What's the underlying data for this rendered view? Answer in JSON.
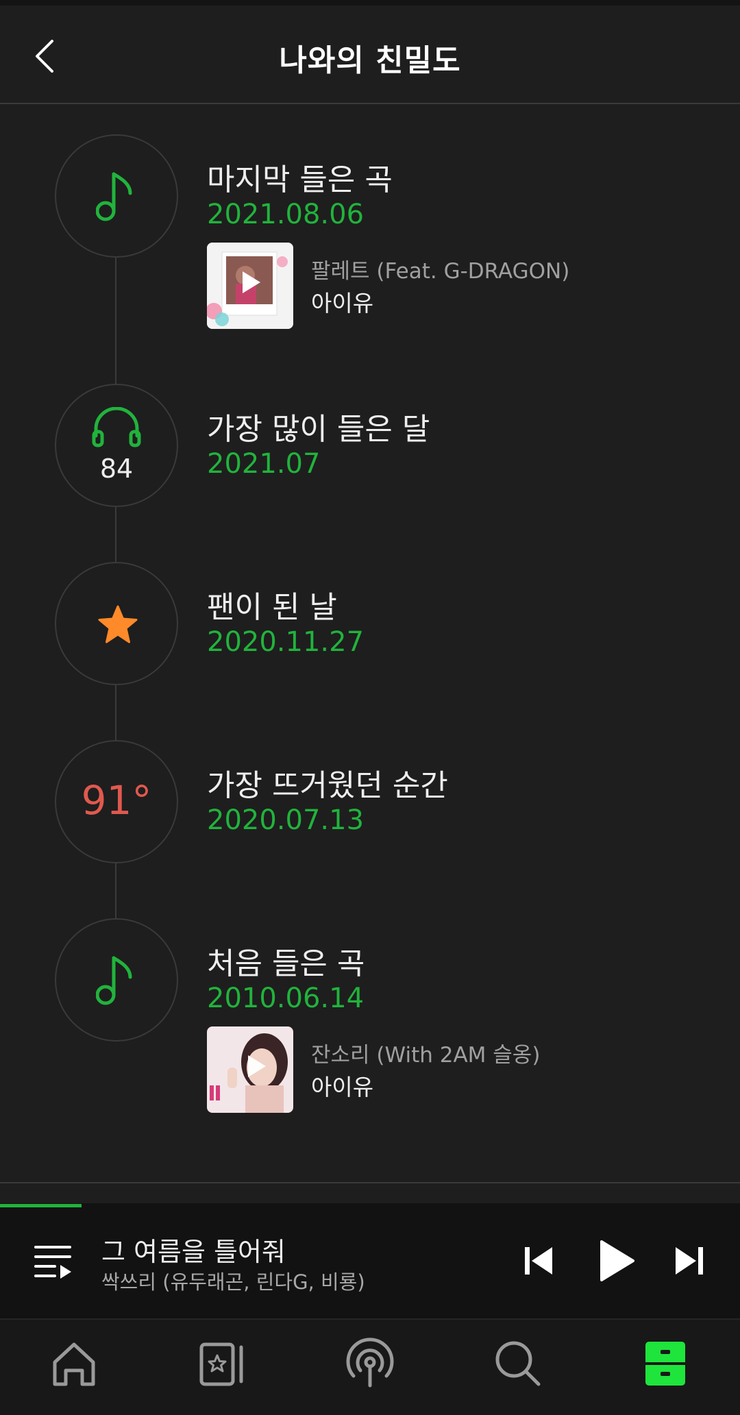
{
  "header": {
    "title": "나와의 친밀도"
  },
  "timeline": [
    {
      "icon": "music-note-icon",
      "title": "마지막 들은 곡",
      "date": "2021.08.06",
      "song": {
        "title": "팔레트 (Feat. G-DRAGON)",
        "artist": "아이유"
      }
    },
    {
      "icon": "headphones-icon",
      "count": "84",
      "title": "가장 많이 들은 달",
      "date": "2021.07"
    },
    {
      "icon": "star-icon",
      "title": "팬이 된 날",
      "date": "2020.11.27"
    },
    {
      "temperature": "91°",
      "title": "가장 뜨거웠던 순간",
      "date": "2020.07.13"
    },
    {
      "icon": "music-note-icon",
      "title": "처음 들은 곡",
      "date": "2010.06.14",
      "song": {
        "title": "잔소리 (With 2AM 슬옹)",
        "artist": "아이유"
      }
    }
  ],
  "player": {
    "title": "그 여름을 틀어줘",
    "artist": "싹쓰리 (유두래곤, 린다G, 비룡)",
    "progress": 0.11
  },
  "nav": {
    "items": [
      "home-icon",
      "my-music-icon",
      "podcast-icon",
      "search-icon",
      "library-icon"
    ],
    "active": "library-icon"
  },
  "colors": {
    "accent": "#21b33c",
    "star": "#ff8a2a",
    "temperature": "#e0594e",
    "background": "#1e1e1e"
  }
}
